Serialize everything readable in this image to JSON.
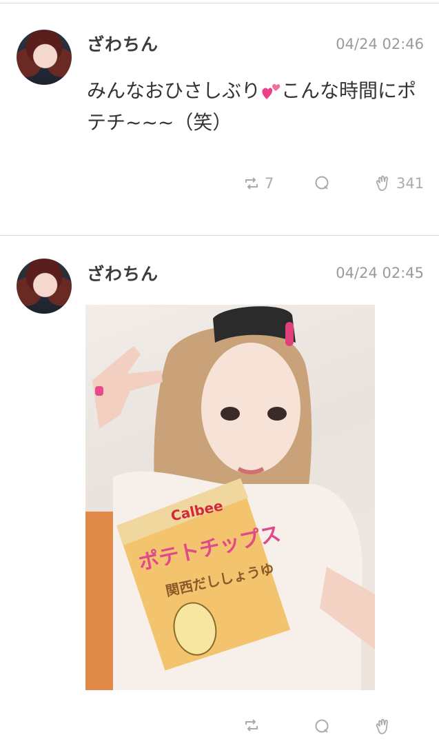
{
  "posts": [
    {
      "username": "ざわちん",
      "timestamp": "04/24 02:46",
      "text_before": "みんなおひさしぶり",
      "text_after": "こんな時間にポテチ~~~（笑）",
      "retweet_count": "7",
      "reply_count": "",
      "clap_count": "341"
    },
    {
      "username": "ざわちん",
      "timestamp": "04/24 02:45",
      "photo": {
        "bag_brand": "Calbee",
        "bag_title": "ポテトチップス",
        "bag_flavor": "関西だししょうゆ"
      }
    }
  ],
  "colors": {
    "separator": "#d9d9d9",
    "timestamp": "#9a9a9a",
    "action": "#aaaaaa",
    "heart": "#e8428c"
  }
}
